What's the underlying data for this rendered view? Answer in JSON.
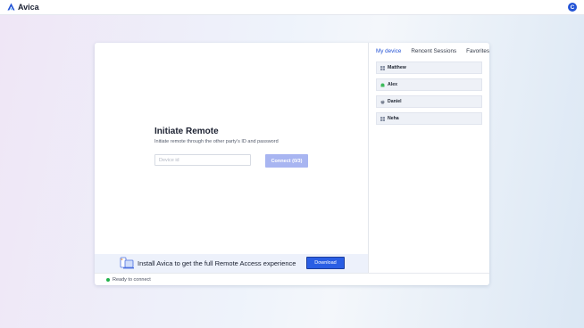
{
  "app": {
    "name": "Avica",
    "user_initial": "C"
  },
  "main": {
    "title": "Initiate Remote",
    "subtitle": "Initiate remote through the other party's ID and password",
    "device_input": {
      "placeholder": "Device id",
      "value": ""
    },
    "connect_label": "Connect (0/3)"
  },
  "promo": {
    "text": "Install Avica to get the full Remote Access experience",
    "download_label": "Download"
  },
  "status": {
    "text": "Ready to connect",
    "color": "#22b24c"
  },
  "panel": {
    "tabs": [
      {
        "label": "My device",
        "active": true
      },
      {
        "label": "Rencent Sessions",
        "active": false
      },
      {
        "label": "Favorites",
        "active": false
      }
    ],
    "devices": [
      {
        "name": "Matthew",
        "icon": "windows-icon"
      },
      {
        "name": "Alex",
        "icon": "android-icon"
      },
      {
        "name": "Daniel",
        "icon": "apple-icon"
      },
      {
        "name": "Neha",
        "icon": "windows-icon"
      }
    ]
  },
  "colors": {
    "accent": "#2a5ee4",
    "connect_disabled": "#a8b5f1",
    "brand": "#2454d6"
  }
}
